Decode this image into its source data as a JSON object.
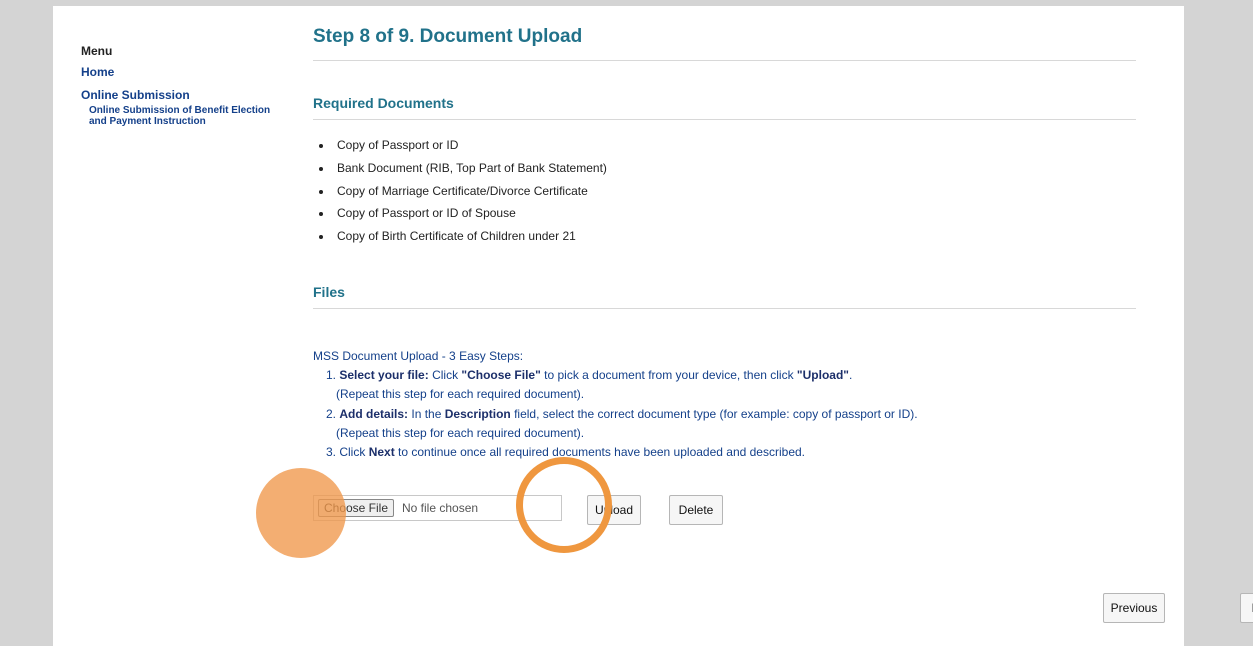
{
  "sidebar": {
    "heading": "Menu",
    "home": "Home",
    "online_submission": "Online Submission",
    "sub_item": "Online Submission of Benefit Election and Payment Instruction"
  },
  "main": {
    "title": "Step 8 of 9. Document Upload",
    "required_heading": "Required Documents",
    "required_documents": [
      "Copy of Passport or ID",
      "Bank Document (RIB, Top Part of Bank Statement)",
      "Copy of Marriage Certificate/Divorce Certificate",
      "Copy of Passport or ID of Spouse",
      "Copy of Birth Certificate of Children under 21"
    ],
    "files_heading": "Files",
    "instructions": {
      "intro": "MSS Document Upload - 3 Easy Steps:",
      "step1_num": "1.",
      "step1_bold": "Select your file:",
      "step1_a": " Click ",
      "step1_choose": "\"Choose File\"",
      "step1_b": " to pick a document from your device, then click ",
      "step1_upload": "\"Upload\"",
      "step1_c": ".",
      "repeat": "(Repeat this step for each required document).",
      "step2_num": "2.",
      "step2_bold": "Add details:",
      "step2_a": " In the ",
      "step2_desc": "Description",
      "step2_b": " field, select the correct document type (for example: copy of passport or ID).",
      "step3_num": "3.",
      "step3_a": " Click ",
      "step3_next": "Next",
      "step3_b": " to continue once all required documents have been uploaded and described."
    },
    "file_input": {
      "choose_label": "Choose File",
      "status": "No file chosen"
    },
    "upload_label": "Upload",
    "delete_label": "Delete",
    "previous_label": "Previous",
    "next_label": "Next"
  },
  "colors": {
    "heading": "#21728a",
    "link": "#14408a",
    "highlight": "#ef973f",
    "backdrop": "#d4d4d4"
  }
}
